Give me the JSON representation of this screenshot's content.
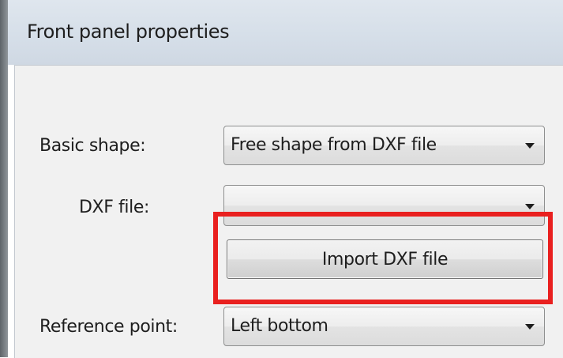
{
  "window": {
    "title": "Front panel properties"
  },
  "form": {
    "basic_shape": {
      "label": "Basic shape:",
      "value": "Free shape from DXF file"
    },
    "dxf_file": {
      "label": "DXF file:",
      "value": ""
    },
    "import_button": {
      "label": "Import DXF file"
    },
    "reference_point": {
      "label": "Reference point:",
      "value": "Left bottom"
    }
  },
  "annotation": {
    "highlight_color": "#e9201f",
    "target": "import-dxf-button"
  },
  "icons": {
    "dropdown": "chevron-down-icon"
  }
}
